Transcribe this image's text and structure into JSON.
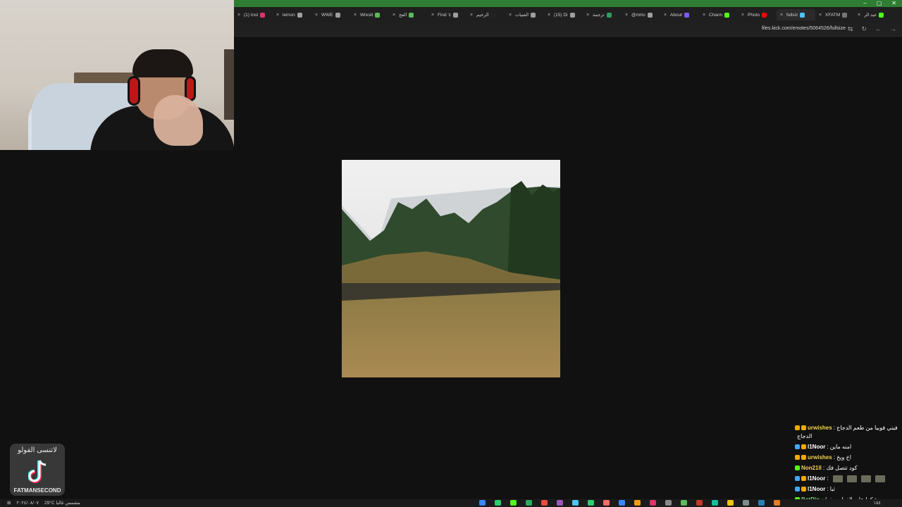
{
  "browser": {
    "window_controls": [
      "–",
      "▢",
      "✕"
    ],
    "tabs": [
      {
        "label": "(1) Inst",
        "color": "#e1306c"
      },
      {
        "label": "lemon",
        "color": "#9e9e9e"
      },
      {
        "label": "WWE",
        "color": "#9e9e9e"
      },
      {
        "label": "Wrestl",
        "color": "#5cb85c"
      },
      {
        "label": "الفج",
        "color": "#5cb85c"
      },
      {
        "label": "Find 'c",
        "color": "#9e9e9e"
      },
      {
        "label": "الرخيم",
        "color": "#222222"
      },
      {
        "label": "الفتيات",
        "color": "#9e9e9e"
      },
      {
        "label": "(15) Di",
        "color": "#9e9e9e"
      },
      {
        "label": "ترجمة",
        "color": "#2e9e5e"
      },
      {
        "label": "@mrto",
        "color": "#9e9e9e"
      },
      {
        "label": "About",
        "color": "#7a5af8"
      },
      {
        "label": "Chann",
        "color": "#53fc18"
      },
      {
        "label": "Photo",
        "color": "#ff0000"
      },
      {
        "label": "fullsiz",
        "color": "#4fc3f7"
      },
      {
        "label": "XFATM",
        "color": "#777777"
      },
      {
        "label": "عبد الر",
        "color": "#53fc18"
      }
    ],
    "active_tab_index": 14,
    "url": "files.kick.com/emotes/5064526/fullsize"
  },
  "tiktok": {
    "arabic_text": "لاتنسى الفولو",
    "handle": "FATMANSECOND"
  },
  "chat": {
    "messages": [
      {
        "user": "urwishes",
        "text": ": فيني فوبيا من طعم الدجاج",
        "wrap": "الدجاج",
        "color": "yellow",
        "badges": [
          "#f2a900",
          "#f2a900"
        ]
      },
      {
        "user": "l1Noor",
        "text": ": امنه ماين",
        "color": "white",
        "badges": [
          "#3fa9f5",
          "#f2a900"
        ]
      },
      {
        "user": "urwishes",
        "text": ": اخ ويخ",
        "color": "yellow",
        "badges": [
          "#f2a900",
          "#f2a900"
        ]
      },
      {
        "user": "Non21ll",
        "text": ": كود تتصل فك",
        "color": "yellow",
        "badges": [
          "#53fc18"
        ]
      },
      {
        "user": "l1Noor",
        "text": ":",
        "color": "white",
        "badges": [
          "#3fa9f5",
          "#f2a900"
        ],
        "emotes": 4
      },
      {
        "user": "l1Noor",
        "text": ": ثبا",
        "color": "white",
        "badges": [
          "#3fa9f5",
          "#f2a900"
        ]
      },
      {
        "user": "BotRix",
        "text": "شكرا على الفولو سفر/ن",
        "color": "green",
        "badges": [
          "#53fc18"
        ]
      }
    ]
  },
  "taskbar": {
    "weather": "29°C مشمس غالبا",
    "date": "٢٠٢٤/٠٨/٠٧",
    "clock": "١٥٤"
  }
}
